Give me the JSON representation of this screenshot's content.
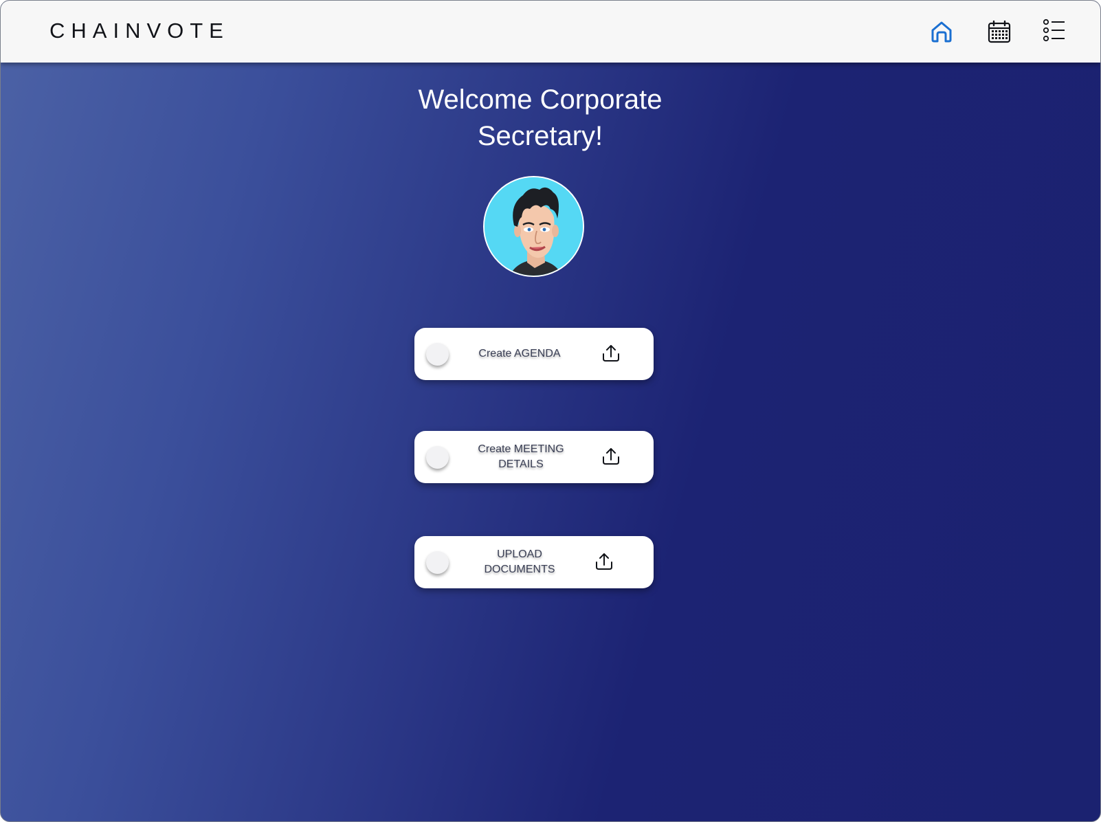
{
  "brand": {
    "name": "CHAINVOTE"
  },
  "nav": {
    "items": [
      {
        "icon": "home-icon",
        "active": true,
        "color": "#1a6fd1"
      },
      {
        "icon": "calendar-icon",
        "active": false,
        "color": "#111318"
      },
      {
        "icon": "list-icon",
        "active": false,
        "color": "#111318"
      }
    ]
  },
  "main": {
    "welcome_line1": "Welcome Corporate",
    "welcome_line2": "Secretary!",
    "avatar": {
      "icon": "user-avatar",
      "background": "#55d8f4"
    },
    "actions": [
      {
        "label_line1": "Create AGENDA",
        "label_line2": "",
        "icon": "upload-icon"
      },
      {
        "label_line1": "Create MEETING",
        "label_line2": "DETAILS",
        "icon": "upload-icon"
      },
      {
        "label_line1": "UPLOAD DOCUMENTS",
        "label_line2": "",
        "icon": "upload-icon"
      }
    ]
  },
  "colors": {
    "gradient_start": "#4c62a6",
    "gradient_end": "#1b2270",
    "topbar": "#f7f7f7",
    "accent": "#1a6fd1"
  }
}
